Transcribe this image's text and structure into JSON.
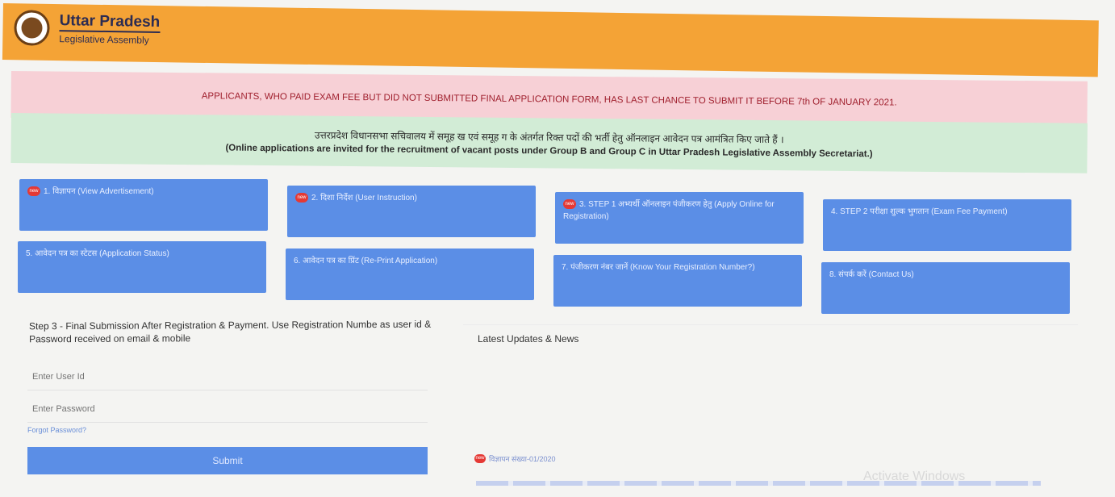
{
  "header": {
    "title": "Uttar Pradesh",
    "subtitle": "Legislative Assembly"
  },
  "notice_pink": "APPLICANTS, WHO PAID EXAM FEE BUT DID NOT SUBMITTED FINAL APPLICATION FORM, HAS LAST CHANCE TO SUBMIT IT BEFORE 7th OF JANUARY 2021.",
  "notice_green": {
    "hindi": "उत्तरप्रदेश विधानसभा सचिवालय में समूह ख एवं समूह ग के अंतर्गत रिक्त पदों की भर्ती हेतु ऑनलाइन आवेदन पत्र आमंत्रित किए जाते हैं ।",
    "english": "(Online applications are invited for the recruitment of vacant posts under Group B and Group C in Uttar Pradesh Legislative Assembly Secretariat.)"
  },
  "badge_text": "new",
  "tiles": [
    {
      "label": "1. विज्ञापन (View Advertisement)",
      "new": true
    },
    {
      "label": "2. दिशा निर्देश (User Instruction)",
      "new": true
    },
    {
      "label": "3. STEP 1 अभ्यर्थी ऑनलाइन पंजीकरण हेतु (Apply Online for Registration)",
      "new": true
    },
    {
      "label": "4. STEP 2 परीक्षा शुल्क भुगतान (Exam Fee Payment)",
      "new": false
    },
    {
      "label": "5. आवेदन पत्र का स्टेटस (Application Status)",
      "new": false
    },
    {
      "label": "6. आवेदन पत्र का प्रिंट (Re-Print Application)",
      "new": false
    },
    {
      "label": "7. पंजीकरण नंबर जानें (Know Your Registration Number?)",
      "new": false
    },
    {
      "label": "8. संपर्क करें (Contact Us)",
      "new": false
    }
  ],
  "login": {
    "instruction": "Step 3 - Final Submission After Registration & Payment. Use Registration Numbe as user id & Password received on email & mobile",
    "user_placeholder": "Enter User Id",
    "password_placeholder": "Enter Password",
    "forgot": "Forgot Password?",
    "submit": "Submit"
  },
  "news": {
    "title": "Latest Updates & News",
    "items": [
      "विज्ञापन संख्या-01/2020"
    ]
  },
  "watermark": "Activate Windows",
  "colors": {
    "header": "#f4a336",
    "tile": "#5b8ee6",
    "notice_pink": "#f7d0d6",
    "notice_green": "#d2ecd6"
  }
}
